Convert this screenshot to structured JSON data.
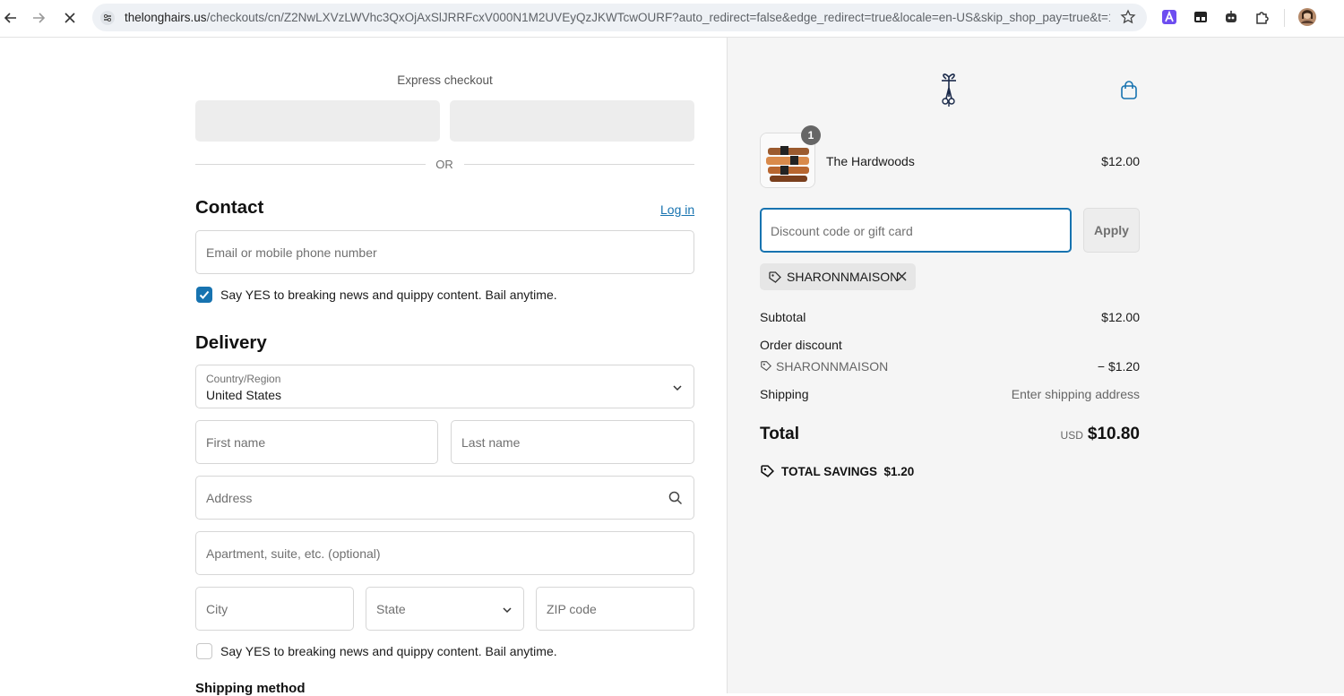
{
  "browser": {
    "url_host": "thelonghairs.us",
    "url_rest": "/checkouts/cn/Z2NwLXVzLWVhc3QxOjAxSlJRRFcxV000N1M2UVEyQzJKWTcwOURF?auto_redirect=false&edge_redirect=true&locale=en-US&skip_shop_pay=true&t=174..."
  },
  "express": {
    "title": "Express checkout",
    "or_label": "OR"
  },
  "contact": {
    "heading": "Contact",
    "login_label": "Log in",
    "email_placeholder": "Email or mobile phone number",
    "newsletter_label": "Say YES to breaking news and quippy content. Bail anytime.",
    "newsletter_checked": true
  },
  "delivery": {
    "heading": "Delivery",
    "country_label": "Country/Region",
    "country_value": "United States",
    "first_name_placeholder": "First name",
    "last_name_placeholder": "Last name",
    "address_placeholder": "Address",
    "apartment_placeholder": "Apartment, suite, etc. (optional)",
    "city_placeholder": "City",
    "state_placeholder": "State",
    "zip_placeholder": "ZIP code",
    "sms_label": "Say YES to breaking news and quippy content. Bail anytime.",
    "sms_checked": false,
    "shipping_method_heading": "Shipping method"
  },
  "summary": {
    "product": {
      "name": "The Hardwoods",
      "price": "$12.00",
      "quantity": "1"
    },
    "discount_placeholder": "Discount code or gift card",
    "apply_label": "Apply",
    "applied_code": "SHARONNMAISON",
    "subtotal_label": "Subtotal",
    "subtotal_value": "$12.00",
    "order_discount_label": "Order discount",
    "discount_code": "SHARONNMAISON",
    "discount_value": "− $1.20",
    "shipping_label": "Shipping",
    "shipping_value": "Enter shipping address",
    "total_label": "Total",
    "total_currency": "USD",
    "total_value": "$10.80",
    "savings_label": "TOTAL SAVINGS",
    "savings_value": "$1.20"
  },
  "colors": {
    "accent": "#1773b0",
    "summary_bg": "#f5f5f5"
  }
}
